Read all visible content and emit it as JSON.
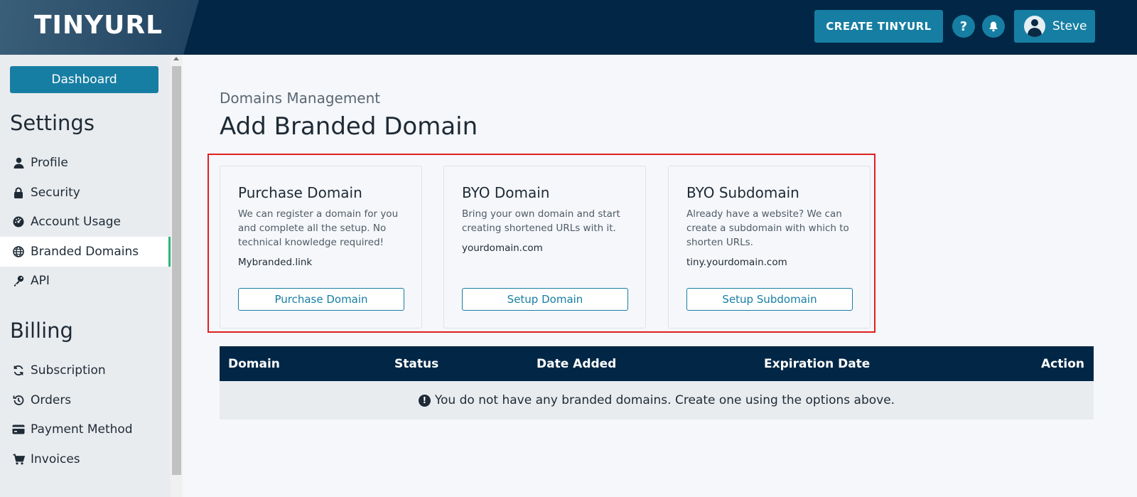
{
  "header": {
    "logo": "TINYURL",
    "create_button": "CREATE TINYURL",
    "help_icon": "question-icon",
    "notifications_icon": "bell-icon",
    "user_name": "Steve"
  },
  "sidebar": {
    "dashboard_button": "Dashboard",
    "settings_title": "Settings",
    "settings_items": [
      {
        "label": "Profile",
        "icon": "user-icon"
      },
      {
        "label": "Security",
        "icon": "lock-icon"
      },
      {
        "label": "Account Usage",
        "icon": "gauge-icon"
      },
      {
        "label": "Branded Domains",
        "icon": "globe-icon",
        "active": true
      },
      {
        "label": "API",
        "icon": "key-icon"
      }
    ],
    "billing_title": "Billing",
    "billing_items": [
      {
        "label": "Subscription",
        "icon": "sync-icon"
      },
      {
        "label": "Orders",
        "icon": "history-icon"
      },
      {
        "label": "Payment Method",
        "icon": "credit-card-icon"
      },
      {
        "label": "Invoices",
        "icon": "cart-icon"
      }
    ]
  },
  "main": {
    "breadcrumb": "Domains Management",
    "title": "Add Branded Domain",
    "cards": [
      {
        "title": "Purchase Domain",
        "description": "We can register a domain for you and complete all the setup. No technical knowledge required!",
        "example": "Mybranded.link",
        "button": "Purchase Domain"
      },
      {
        "title": "BYO Domain",
        "description": "Bring your own domain and start creating shortened URLs with it.",
        "example": "yourdomain.com",
        "button": "Setup Domain"
      },
      {
        "title": "BYO Subdomain",
        "description": "Already have a website? We can create a subdomain with which to shorten URLs.",
        "example": "tiny.yourdomain.com",
        "button": "Setup Subdomain"
      }
    ],
    "table": {
      "columns": [
        "Domain",
        "Status",
        "Date Added",
        "Expiration Date",
        "Action"
      ],
      "empty_message": "You do not have any branded domains. Create one using the options above."
    }
  },
  "colors": {
    "header_bg": "#022746",
    "accent": "#177ea3",
    "active_indicator": "#2fb67a",
    "highlight_border": "#e02020"
  }
}
